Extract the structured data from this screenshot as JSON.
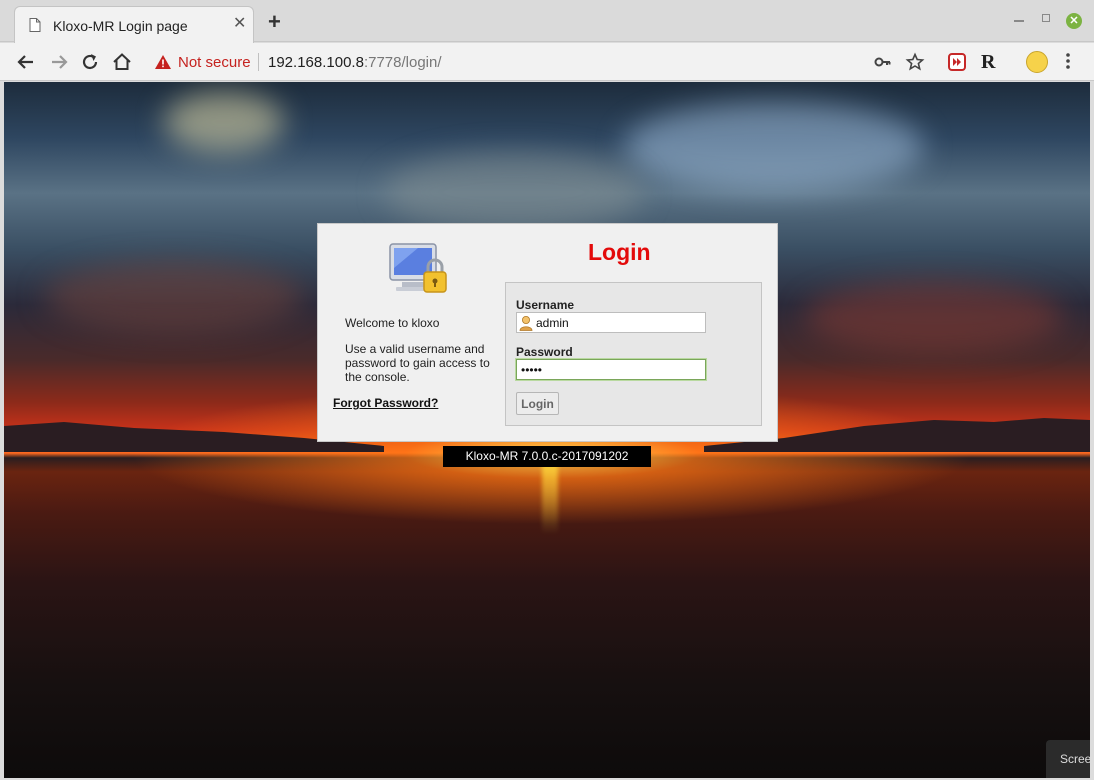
{
  "browser": {
    "tab_title": "Kloxo-MR Login page",
    "security_label": "Not secure",
    "url_host": "192.168.100.8",
    "url_rest": ":7778/login/",
    "new_tab_symbol": "+",
    "close_symbol": "✕",
    "extension_r": "R"
  },
  "icons": [
    "page-icon",
    "back-arrow-icon",
    "forward-arrow-icon",
    "reload-icon",
    "home-icon",
    "warning-icon",
    "key-icon",
    "star-icon",
    "extension-icon",
    "avatar-icon",
    "more-icon",
    "user-icon",
    "computer-lock-icon"
  ],
  "login": {
    "title": "Login",
    "welcome": "Welcome to kloxo",
    "description": "Use a valid username and password to gain access to the console.",
    "forgot_link": "Forgot Password?",
    "username_label": "Username",
    "username_value": "admin",
    "password_label": "Password",
    "password_value": "•••••",
    "submit_label": "Login"
  },
  "footer": {
    "version": "Kloxo-MR 7.0.0.c-2017091202"
  },
  "popup": {
    "text": "Screen"
  },
  "colors": {
    "title_red": "#e30a0a",
    "insecure_red": "#c5221f"
  }
}
